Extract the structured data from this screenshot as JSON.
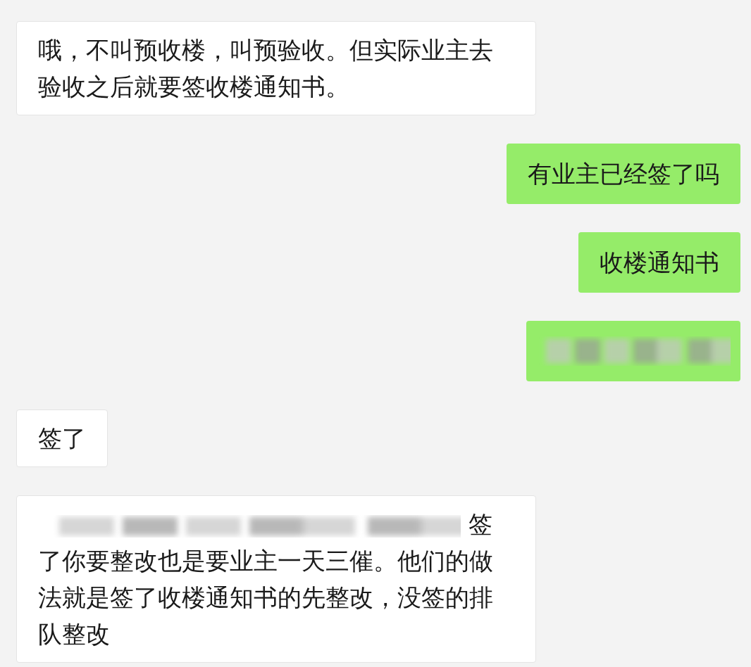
{
  "messages": [
    {
      "outgoing": false,
      "kind": "text",
      "text": "哦，不叫预收楼，叫预验收。但实际业主去验收之后就要签收楼通知书。"
    },
    {
      "outgoing": true,
      "kind": "text",
      "text": "有业主已经签了吗"
    },
    {
      "outgoing": true,
      "kind": "text",
      "text": "收楼通知书"
    },
    {
      "outgoing": true,
      "kind": "redacted"
    },
    {
      "outgoing": false,
      "kind": "text",
      "text": "签了"
    },
    {
      "outgoing": false,
      "kind": "partly_redacted",
      "text": "签了你要整改也是要业主一天三催。他们的做法就是签了收楼通知书的先整改，没签的排队整改"
    }
  ]
}
